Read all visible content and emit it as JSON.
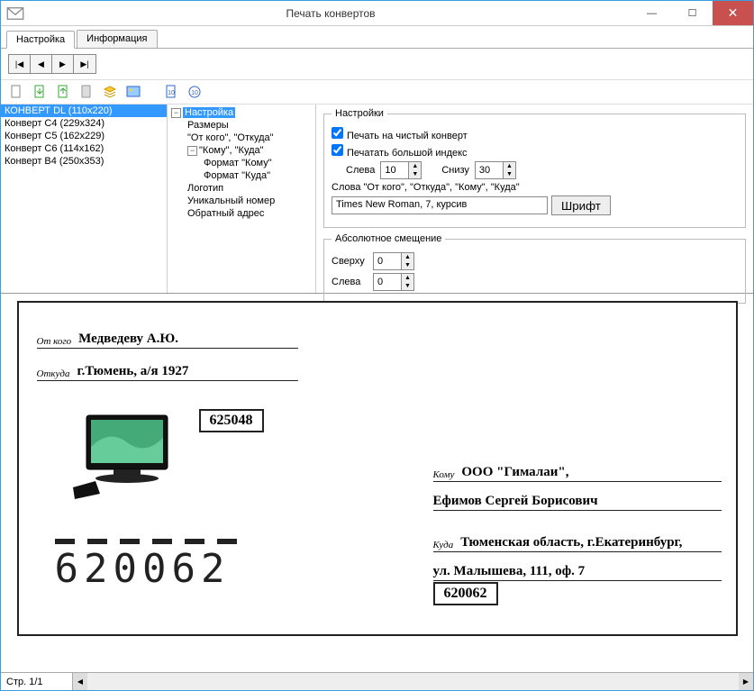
{
  "window": {
    "title": "Печать конвертов"
  },
  "tabs": {
    "tab1": "Настройка",
    "tab2": "Информация"
  },
  "envelopes": {
    "e0": "КОНВЕРТ DL (110х220)",
    "e1": "Конверт C4 (229x324)",
    "e2": "Конверт C5 (162x229)",
    "e3": "Конверт C6 (114x162)",
    "e4": "Конверт B4 (250x353)"
  },
  "tree": {
    "root": "Настройка",
    "n1": "Размеры",
    "n2": "\"От кого\", \"Откуда\"",
    "n3": "\"Кому\", \"Куда\"",
    "n3a": "Формат \"Кому\"",
    "n3b": "Формат \"Куда\"",
    "n4": "Логотип",
    "n5": "Уникальный номер",
    "n6": "Обратный адрес"
  },
  "settings": {
    "legend": "Настройки",
    "cb1": "Печать на чистый конверт",
    "cb2": "Печатать большой индекс",
    "lbl_left": "Слева",
    "val_left": "10",
    "lbl_bottom": "Снизу",
    "val_bottom": "30",
    "words_label": "Слова \"От кого\", \"Откуда\", \"Кому\", \"Куда\"",
    "font_desc": "Times New Roman, 7, курсив",
    "font_btn": "Шрифт",
    "offset_legend": "Абсолютное смещение",
    "lbl_top": "Сверху",
    "val_top": "0",
    "lbl_left2": "Слева",
    "val_left2": "0"
  },
  "envelope": {
    "from_label": "От кого",
    "from_value": "Медведеву А.Ю.",
    "fromaddr_label": "Откуда",
    "fromaddr_value": "г.Тюмень, а/я 1927",
    "from_index": "625048",
    "to_label": "Кому",
    "to_line1": "ООО \"Гималаи\",",
    "to_line2": "Ефимов Сергей Борисович",
    "toaddr_label": "Куда",
    "toaddr_line1": "Тюменская область, г.Екатеринбург,",
    "toaddr_line2": "ул. Малышева, 111, оф. 7",
    "to_index": "620062",
    "big_index": "620062"
  },
  "status": {
    "page": "Стр. 1/1"
  }
}
